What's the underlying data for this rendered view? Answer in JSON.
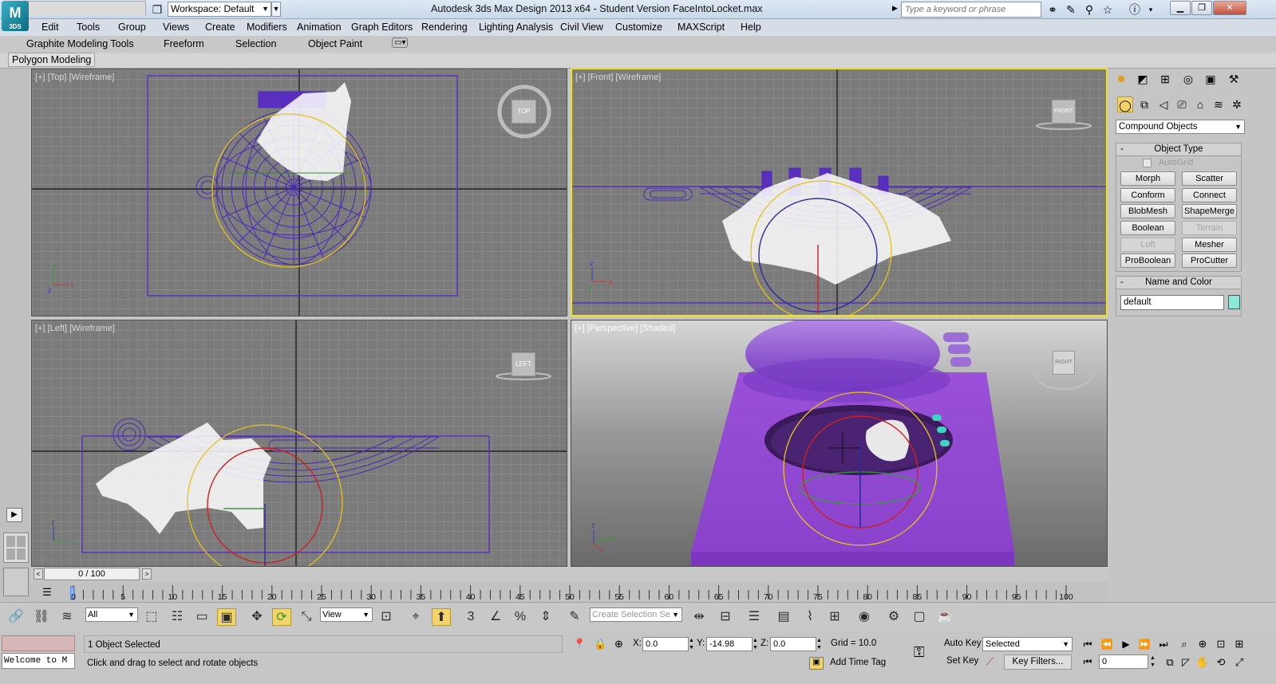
{
  "window": {
    "title": "Autodesk 3ds Max Design 2013 x64 - Student Version     FaceIntoLocket.max",
    "logo_text": "M",
    "logo_sub": "3DS",
    "workspace": "Workspace: Default",
    "search_placeholder": "Type a keyword or phrase"
  },
  "menu": [
    "Edit",
    "Tools",
    "Group",
    "Views",
    "Create",
    "Modifiers",
    "Animation",
    "Graph Editors",
    "Rendering",
    "Lighting Analysis",
    "Civil View",
    "Customize",
    "MAXScript",
    "Help"
  ],
  "ribbon": {
    "tabs": [
      "Graphite Modeling Tools",
      "Freeform",
      "Selection",
      "Object Paint"
    ],
    "panel_tab": "Polygon Modeling"
  },
  "viewports": {
    "top": "[+] [Top] [Wireframe]",
    "front": "[+] [Front] [Wireframe]",
    "left": "[+] [Left] [Wireframe]",
    "perspective": "[+] [Perspective] [Shaded]",
    "viewcube_top": "TOP",
    "viewcube_front": "FRONT",
    "viewcube_left": "LEFT",
    "viewcube_persp": "RIGHT"
  },
  "command_panel": {
    "category": "Compound Objects",
    "object_type_title": "Object Type",
    "autogrid": "AutoGrid",
    "buttons": [
      {
        "label": "Morph",
        "enabled": true
      },
      {
        "label": "Scatter",
        "enabled": true
      },
      {
        "label": "Conform",
        "enabled": true
      },
      {
        "label": "Connect",
        "enabled": true
      },
      {
        "label": "BlobMesh",
        "enabled": true
      },
      {
        "label": "ShapeMerge",
        "enabled": true
      },
      {
        "label": "Boolean",
        "enabled": true
      },
      {
        "label": "Terrain",
        "enabled": false
      },
      {
        "label": "Loft",
        "enabled": false
      },
      {
        "label": "Mesher",
        "enabled": true
      },
      {
        "label": "ProBoolean",
        "enabled": true
      },
      {
        "label": "ProCutter",
        "enabled": true
      }
    ],
    "name_color_title": "Name and Color",
    "name_value": "default",
    "color": "#8ee8d8"
  },
  "timeline": {
    "frame_display": "0 / 100",
    "ticks": [
      "0",
      "5",
      "10",
      "15",
      "20",
      "25",
      "30",
      "35",
      "40",
      "45",
      "50",
      "55",
      "60",
      "65",
      "70",
      "75",
      "80",
      "85",
      "90",
      "95",
      "100"
    ]
  },
  "toolbar": {
    "selection_filter": "All",
    "ref_coord": "View",
    "named_selection": "Create Selection Se"
  },
  "status": {
    "listener": "Welcome to M",
    "line1": "1 Object Selected",
    "line2": "Click and drag to select and rotate objects",
    "x_label": "X:",
    "x_value": "0.0",
    "y_label": "Y:",
    "y_value": "-14.98",
    "z_label": "Z:",
    "z_value": "0.0",
    "grid": "Grid = 10.0",
    "add_time_tag": "Add Time Tag",
    "auto_key": "Auto Key",
    "set_key": "Set Key",
    "key_mode": "Selected",
    "key_filters": "Key Filters...",
    "current_frame": "0"
  },
  "colors": {
    "active_viewport": "#f3e01d",
    "wire_purple": "#5a2fc0",
    "object_purple": "#9b4fd6"
  }
}
